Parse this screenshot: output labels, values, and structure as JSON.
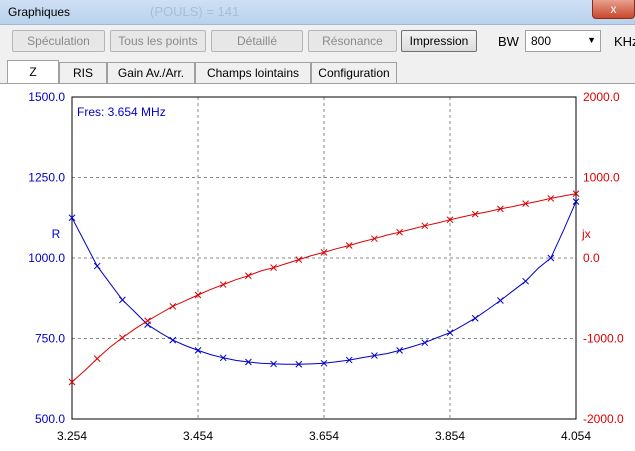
{
  "window": {
    "title": "Graphiques",
    "background_title": "(POULS) = 141",
    "close_label": "x"
  },
  "toolbar": {
    "buttons": [
      {
        "label": "Spéculation",
        "enabled": false
      },
      {
        "label": "Tous les points",
        "enabled": false
      },
      {
        "label": "Détaillé",
        "enabled": false
      },
      {
        "label": "Résonance",
        "enabled": false
      },
      {
        "label": "Impression",
        "enabled": true
      }
    ],
    "bw_label": "BW",
    "bw_value": "800",
    "unit_label": "KHz"
  },
  "tabs": {
    "items": [
      {
        "label": "Z",
        "selected": true
      },
      {
        "label": "RIS",
        "selected": false
      },
      {
        "label": "Gain Av./Arr.",
        "selected": false
      },
      {
        "label": "Champs lointains",
        "selected": false
      },
      {
        "label": "Configuration",
        "selected": false
      }
    ]
  },
  "chart_data": {
    "type": "line",
    "annotation": "Fres: 3.654 MHz",
    "xlim": [
      3.254,
      4.054
    ],
    "x_ticks": [
      "3.254",
      "3.454",
      "3.654",
      "3.854",
      "4.054"
    ],
    "y_left": {
      "label": "R",
      "lim": [
        500,
        1500
      ],
      "ticks": [
        "500.0",
        "750.0",
        "1000.0",
        "1250.0",
        "1500.0"
      ],
      "color": "#0000cc"
    },
    "y_right": {
      "label": "jx",
      "lim": [
        -2000,
        2000
      ],
      "ticks": [
        "-2000.0",
        "-1000.0",
        "0.0",
        "1000.0",
        "2000.0"
      ],
      "color": "#dd0000"
    },
    "grid": true,
    "series": [
      {
        "axis": "left",
        "color": "#0000cc",
        "x": [
          3.254,
          3.274,
          3.294,
          3.314,
          3.334,
          3.354,
          3.374,
          3.394,
          3.414,
          3.434,
          3.454,
          3.474,
          3.494,
          3.514,
          3.534,
          3.554,
          3.574,
          3.594,
          3.614,
          3.634,
          3.654,
          3.674,
          3.694,
          3.714,
          3.734,
          3.754,
          3.774,
          3.794,
          3.814,
          3.834,
          3.854,
          3.874,
          3.894,
          3.914,
          3.934,
          3.954,
          3.974,
          3.994,
          4.014,
          4.034,
          4.054
        ],
        "values": [
          1125,
          1050,
          975,
          922,
          870,
          832,
          793,
          768,
          745,
          728,
          713,
          700,
          690,
          682,
          677,
          673,
          671,
          670,
          670,
          671,
          673,
          678,
          683,
          690,
          697,
          703,
          713,
          725,
          737,
          753,
          768,
          790,
          813,
          840,
          868,
          898,
          928,
          968,
          1000,
          1085,
          1175
        ],
        "marker_step": 2
      },
      {
        "axis": "right",
        "color": "#dd0000",
        "x": [
          3.254,
          3.274,
          3.294,
          3.314,
          3.334,
          3.354,
          3.374,
          3.394,
          3.414,
          3.434,
          3.454,
          3.474,
          3.494,
          3.514,
          3.534,
          3.554,
          3.574,
          3.594,
          3.614,
          3.634,
          3.654,
          3.674,
          3.694,
          3.714,
          3.734,
          3.754,
          3.774,
          3.794,
          3.814,
          3.834,
          3.854,
          3.874,
          3.894,
          3.914,
          3.934,
          3.954,
          3.974,
          3.994,
          4.014,
          4.034,
          4.054
        ],
        "values": [
          -1540,
          -1400,
          -1250,
          -1110,
          -990,
          -880,
          -780,
          -690,
          -600,
          -530,
          -460,
          -390,
          -330,
          -270,
          -220,
          -160,
          -120,
          -70,
          -20,
          30,
          70,
          115,
          155,
          200,
          240,
          285,
          320,
          360,
          400,
          435,
          475,
          510,
          545,
          575,
          610,
          640,
          675,
          705,
          740,
          770,
          800
        ],
        "marker_step": 2
      }
    ]
  }
}
